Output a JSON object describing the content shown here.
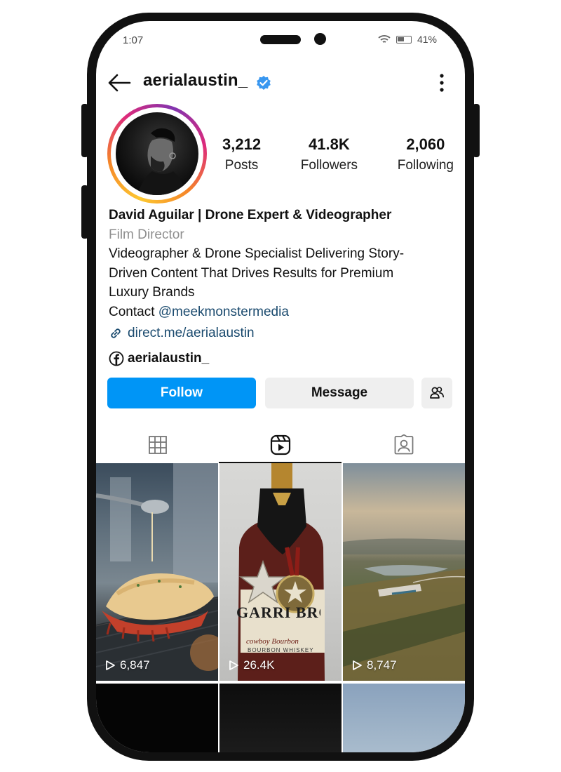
{
  "status_bar": {
    "time": "1:07",
    "battery": "41%"
  },
  "header": {
    "username": "aerialaustin_"
  },
  "stats": [
    {
      "value": "3,212",
      "label": "Posts"
    },
    {
      "value": "41.8K",
      "label": "Followers"
    },
    {
      "value": "2,060",
      "label": "Following"
    }
  ],
  "bio": {
    "name": "David Aguilar | Drone Expert & Videographer",
    "category": "Film Director",
    "line1": "Videographer & Drone Specialist Delivering Story-",
    "line2": "Driven Content That Drives Results for Premium",
    "line3": "Luxury Brands",
    "contact_prefix": "Contact ",
    "contact_mention": "@meekmonstermedia",
    "link": "direct.me/aerialaustin",
    "facebook": "aerialaustin_"
  },
  "actions": {
    "follow": "Follow",
    "message": "Message"
  },
  "tabs": {
    "active": "reels"
  },
  "reels": [
    {
      "views": "6,847"
    },
    {
      "views": "26.4K"
    },
    {
      "views": "8,747"
    }
  ],
  "reel_overlay_text": {
    "brand": "GARRI BROTH",
    "sub": "cowboy Bourbon",
    "small": "BOURBON WHISKEY"
  },
  "colors": {
    "accent": "#0095f6",
    "link": "#1a4a6e",
    "verified": "#3897f0"
  }
}
